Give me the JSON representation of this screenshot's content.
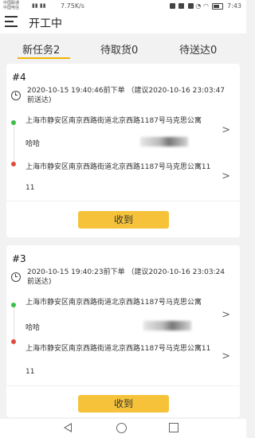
{
  "status_bar": {
    "carrier_1": "中国联通",
    "carrier_2": "中国电信",
    "net_speed": "7.75K/s",
    "battery": "▮",
    "time": "7:43"
  },
  "app_bar": {
    "title": "开工中",
    "menu_icon": "menu-icon"
  },
  "tabs": [
    {
      "label": "新任务2",
      "active": true
    },
    {
      "label": "待取货0",
      "active": false
    },
    {
      "label": "待送达0",
      "active": false
    }
  ],
  "colors": {
    "accent": "#f0b400",
    "button": "#f5c23a",
    "pickup_dot": "#3cbf4a",
    "dropoff_dot": "#e04b3c"
  },
  "orders": [
    {
      "order_no": "#4",
      "time_text": "2020-10-15 19:40:46前下单 （建议2020-10-16 23:03:47前送达)",
      "pickup_address": "上海市静安区南京西路街道北京西路1187号马克思公寓",
      "pickup_contact": "哈哈",
      "dropoff_address": "上海市静安区南京西路街道北京西路1187号马克思公寓11",
      "dropoff_contact": "11",
      "button_label": "收到"
    },
    {
      "order_no": "#3",
      "time_text": "2020-10-15 19:40:23前下单 （建议2020-10-16 23:03:24前送达)",
      "pickup_address": "上海市静安区南京西路街道北京西路1187号马克思公寓",
      "pickup_contact": "哈哈",
      "dropoff_address": "上海市静安区南京西路街道北京西路1187号马克思公寓11",
      "dropoff_contact": "11",
      "button_label": "收到"
    }
  ],
  "chevron": ">"
}
